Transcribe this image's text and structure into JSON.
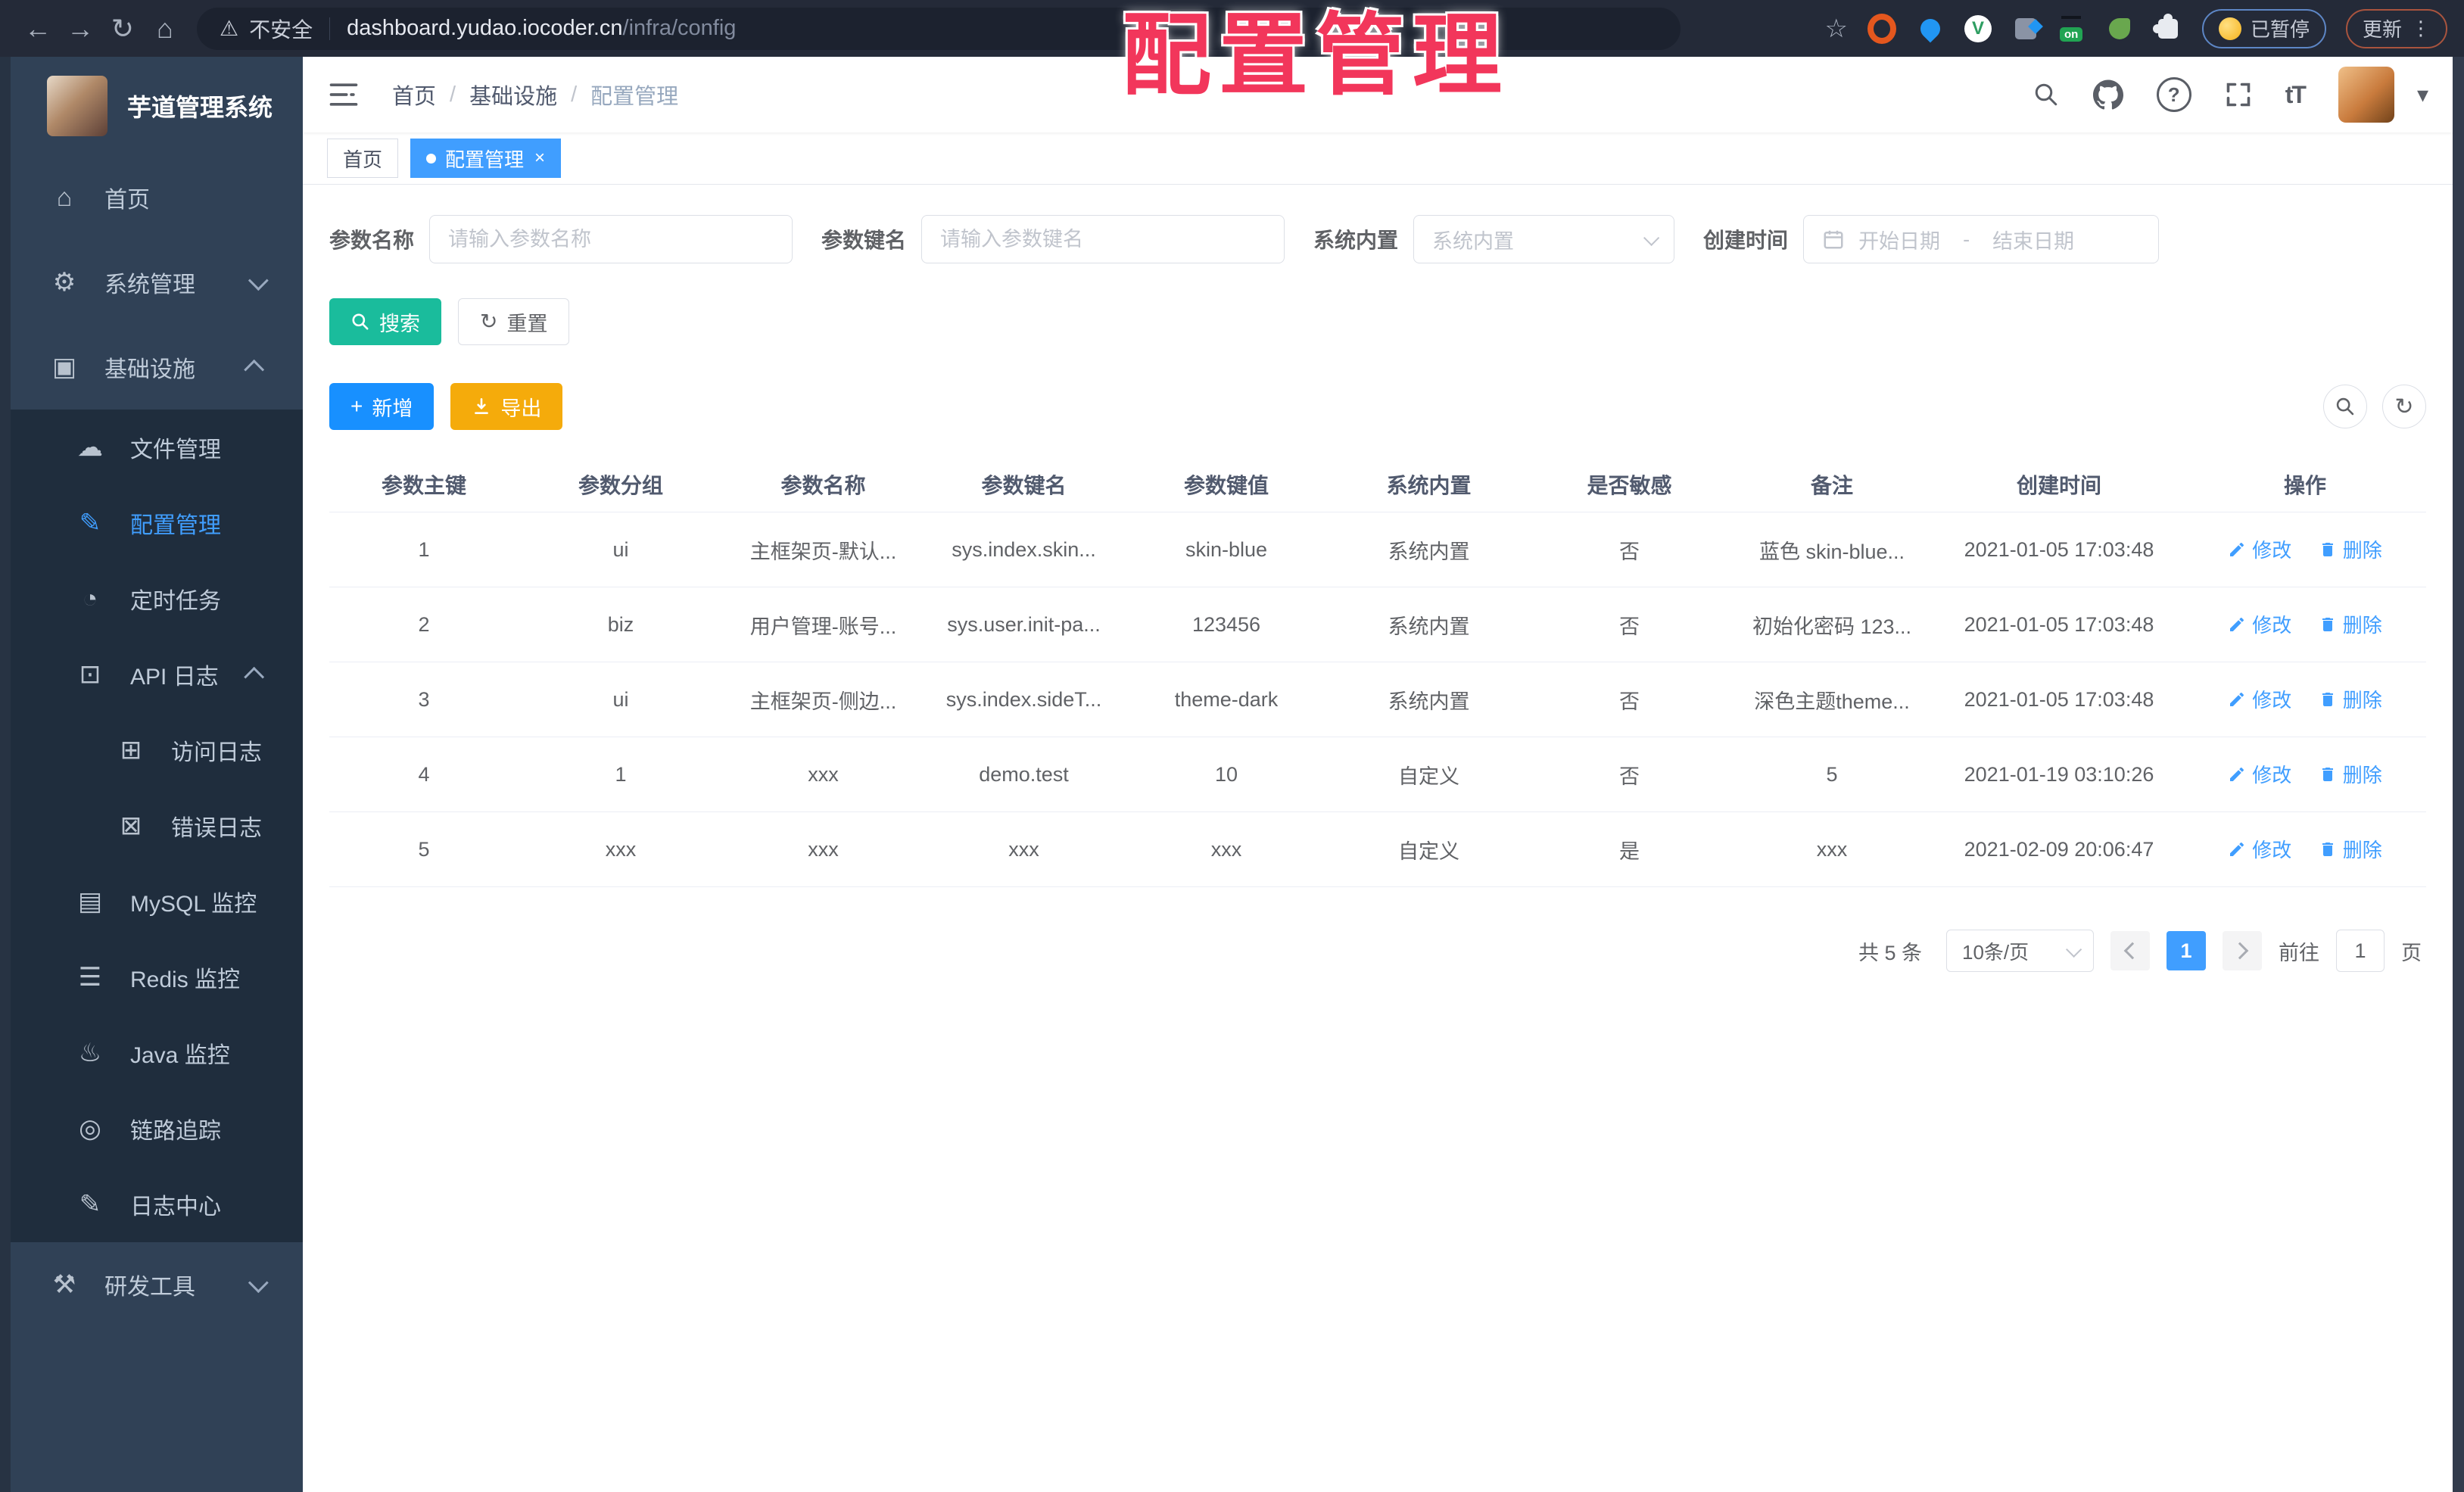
{
  "colors": {
    "chrome_bg": "#242a38",
    "sidebar_bg": "#304156",
    "submenu_bg": "#1f2d3d",
    "primary_blue": "#409eff",
    "add_blue": "#1890ff",
    "search_teal": "#1abc9c",
    "export_orange": "#f5ab0b",
    "overlay_red": "#f2365b"
  },
  "browser": {
    "back_glyph": "←",
    "forward_glyph": "→",
    "reload_glyph": "↻",
    "home_glyph": "⌂",
    "warning_glyph": "⚠",
    "security_label": "不安全",
    "url_host": "dashboard.yudao.iocoder.cn",
    "url_path": "/infra/config",
    "star_glyph": "☆",
    "vue_glyph": "V",
    "on_badge": "on",
    "paused_label": "已暂停",
    "update_label": "更新",
    "kebab_glyph": "⋮"
  },
  "overlay": {
    "title": "配置管理"
  },
  "sidebar": {
    "app_title": "芋道管理系统",
    "items": [
      {
        "glyph": "⌂",
        "label": "首页"
      },
      {
        "glyph": "⚙",
        "label": "系统管理"
      },
      {
        "glyph": "▣",
        "label": "基础设施"
      },
      {
        "glyph": "☁",
        "label": "文件管理"
      },
      {
        "glyph": "✎",
        "label": "配置管理"
      },
      {
        "glyph": "◔",
        "label": "定时任务"
      },
      {
        "glyph": "⊡",
        "label": "API 日志"
      },
      {
        "glyph": "⊞",
        "label": "访问日志"
      },
      {
        "glyph": "⊠",
        "label": "错误日志"
      },
      {
        "glyph": "▤",
        "label": "MySQL 监控"
      },
      {
        "glyph": "☰",
        "label": "Redis 监控"
      },
      {
        "glyph": "♨",
        "label": "Java 监控"
      },
      {
        "glyph": "◎",
        "label": "链路追踪"
      },
      {
        "glyph": "✎",
        "label": "日志中心"
      },
      {
        "glyph": "⚒",
        "label": "研发工具"
      }
    ]
  },
  "header": {
    "breadcrumb": [
      "首页",
      "基础设施",
      "配置管理"
    ],
    "separator": "/",
    "help_glyph": "?",
    "font_size_glyph": "tT",
    "caret_glyph": "▾"
  },
  "tags": {
    "items": [
      {
        "label": "首页"
      },
      {
        "label": "配置管理"
      }
    ],
    "close_glyph": "×"
  },
  "filters": {
    "name_label": "参数名称",
    "name_placeholder": "请输入参数名称",
    "key_label": "参数键名",
    "key_placeholder": "请输入参数键名",
    "type_label": "系统内置",
    "type_placeholder": "系统内置",
    "date_label": "创建时间",
    "date_start_placeholder": "开始日期",
    "date_separator": "-",
    "date_end_placeholder": "结束日期",
    "search_button": "搜索",
    "reset_button": "重置",
    "reset_glyph": "↻"
  },
  "toolbar": {
    "add_button": "新增",
    "add_glyph": "+",
    "export_button": "导出",
    "refresh_glyph": "↻"
  },
  "table": {
    "columns": [
      "参数主键",
      "参数分组",
      "参数名称",
      "参数键名",
      "参数键值",
      "系统内置",
      "是否敏感",
      "备注",
      "创建时间",
      "操作"
    ],
    "edit_label": "修改",
    "delete_label": "删除",
    "rows": [
      {
        "id": "1",
        "group": "ui",
        "name": "主框架页-默认...",
        "key": "sys.index.skin...",
        "value": "skin-blue",
        "builtin": "系统内置",
        "sensitive": "否",
        "remark": "蓝色 skin-blue...",
        "created": "2021-01-05 17:03:48"
      },
      {
        "id": "2",
        "group": "biz",
        "name": "用户管理-账号...",
        "key": "sys.user.init-pa...",
        "value": "123456",
        "builtin": "系统内置",
        "sensitive": "否",
        "remark": "初始化密码 123...",
        "created": "2021-01-05 17:03:48"
      },
      {
        "id": "3",
        "group": "ui",
        "name": "主框架页-侧边...",
        "key": "sys.index.sideT...",
        "value": "theme-dark",
        "builtin": "系统内置",
        "sensitive": "否",
        "remark": "深色主题theme...",
        "created": "2021-01-05 17:03:48"
      },
      {
        "id": "4",
        "group": "1",
        "name": "xxx",
        "key": "demo.test",
        "value": "10",
        "builtin": "自定义",
        "sensitive": "否",
        "remark": "5",
        "created": "2021-01-19 03:10:26"
      },
      {
        "id": "5",
        "group": "xxx",
        "name": "xxx",
        "key": "xxx",
        "value": "xxx",
        "builtin": "自定义",
        "sensitive": "是",
        "remark": "xxx",
        "created": "2021-02-09 20:06:47"
      }
    ]
  },
  "pagination": {
    "total_label": "共 5 条",
    "page_size": "10条/页",
    "current_page": "1",
    "goto_label": "前往",
    "goto_value": "1",
    "page_unit": "页"
  }
}
